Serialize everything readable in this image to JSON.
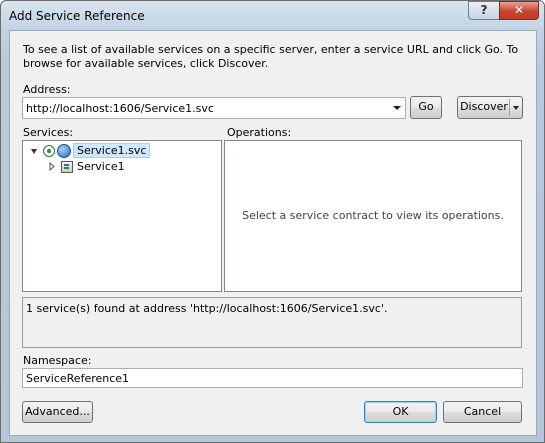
{
  "window": {
    "title": "Add Service Reference",
    "help_glyph": "?",
    "close_glyph": "✕"
  },
  "description": "To see a list of available services on a specific server, enter a service URL and click Go. To browse for available services, click Discover.",
  "address": {
    "label": "Address:",
    "value": "http://localhost:1606/Service1.svc",
    "go_label": "Go",
    "discover_label": "Discover"
  },
  "services": {
    "label": "Services:",
    "tree": [
      {
        "label": "Service1.svc",
        "expanded": true,
        "selected": true,
        "icon": "web-service-icon"
      },
      {
        "label": "Service1",
        "expanded": false,
        "selected": false,
        "icon": "service-class-icon"
      }
    ]
  },
  "operations": {
    "label": "Operations:",
    "empty_message": "Select a service contract to view its operations."
  },
  "status": "1 service(s) found at address 'http://localhost:1606/Service1.svc'.",
  "namespace": {
    "label": "Namespace:",
    "value": "ServiceReference1"
  },
  "buttons": {
    "advanced": "Advanced...",
    "ok": "OK",
    "cancel": "Cancel"
  },
  "colors": {
    "selection_highlight": "#cde8ff",
    "close_button": "#c8452f"
  }
}
